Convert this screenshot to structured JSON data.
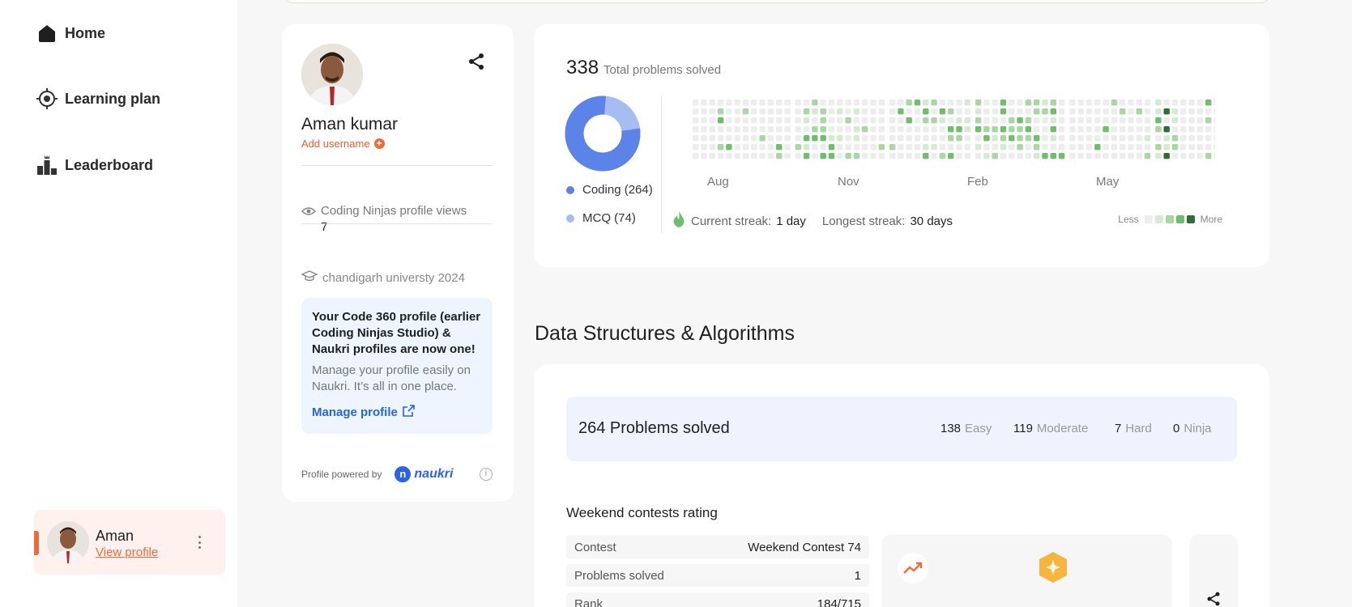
{
  "sidebar": {
    "items": [
      {
        "label": "Home",
        "icon": "home-icon"
      },
      {
        "label": "Learning plan",
        "icon": "target-icon"
      },
      {
        "label": "Leaderboard",
        "icon": "leaderboard-icon"
      }
    ],
    "user": {
      "name": "Aman",
      "link": "View profile"
    }
  },
  "profile": {
    "name": "Aman kumar",
    "add_username": "Add username",
    "views_label": "Coding Ninjas profile views",
    "views_value": "7",
    "college": "chandigarh universty 2024",
    "notice_title": "Your Code 360 profile (earlier Coding Ninjas Studio) & Naukri profiles are now one!",
    "notice_body": "Manage your profile easily on Naukri. It’s all in one place.",
    "notice_link": "Manage profile",
    "powered_by": "Profile powered by",
    "brand": "naukri"
  },
  "stats": {
    "total": "338",
    "total_label": "Total problems solved",
    "coding": "Coding (264)",
    "mcq": "MCQ (74)",
    "months": [
      "Aug",
      "Nov",
      "Feb",
      "May"
    ],
    "current_streak_label": "Current streak:",
    "current_streak": "1 day",
    "longest_streak_label": "Longest streak:",
    "longest_streak": "30 days",
    "less": "Less",
    "more": "More"
  },
  "colors": {
    "accent": "#ef6a3a",
    "coding": "#5b83e8",
    "mcq": "#a7bdf1",
    "heat": [
      "#ededed",
      "#d6ead3",
      "#a8d7a1",
      "#6fbe6b",
      "#2f6e33"
    ]
  },
  "dsa": {
    "title": "Data Structures & Algorithms",
    "solved": "264 Problems solved",
    "easy_n": "138",
    "easy": "Easy",
    "moderate_n": "119",
    "moderate": "Moderate",
    "hard_n": "7",
    "hard": "Hard",
    "ninja_n": "0",
    "ninja": "Ninja",
    "contest_title": "Weekend contests rating",
    "rows": [
      {
        "label": "Contest",
        "value": "Weekend Contest 74"
      },
      {
        "label": "Problems solved",
        "value": "1"
      },
      {
        "label": "Rank",
        "value": "184/715"
      }
    ]
  }
}
